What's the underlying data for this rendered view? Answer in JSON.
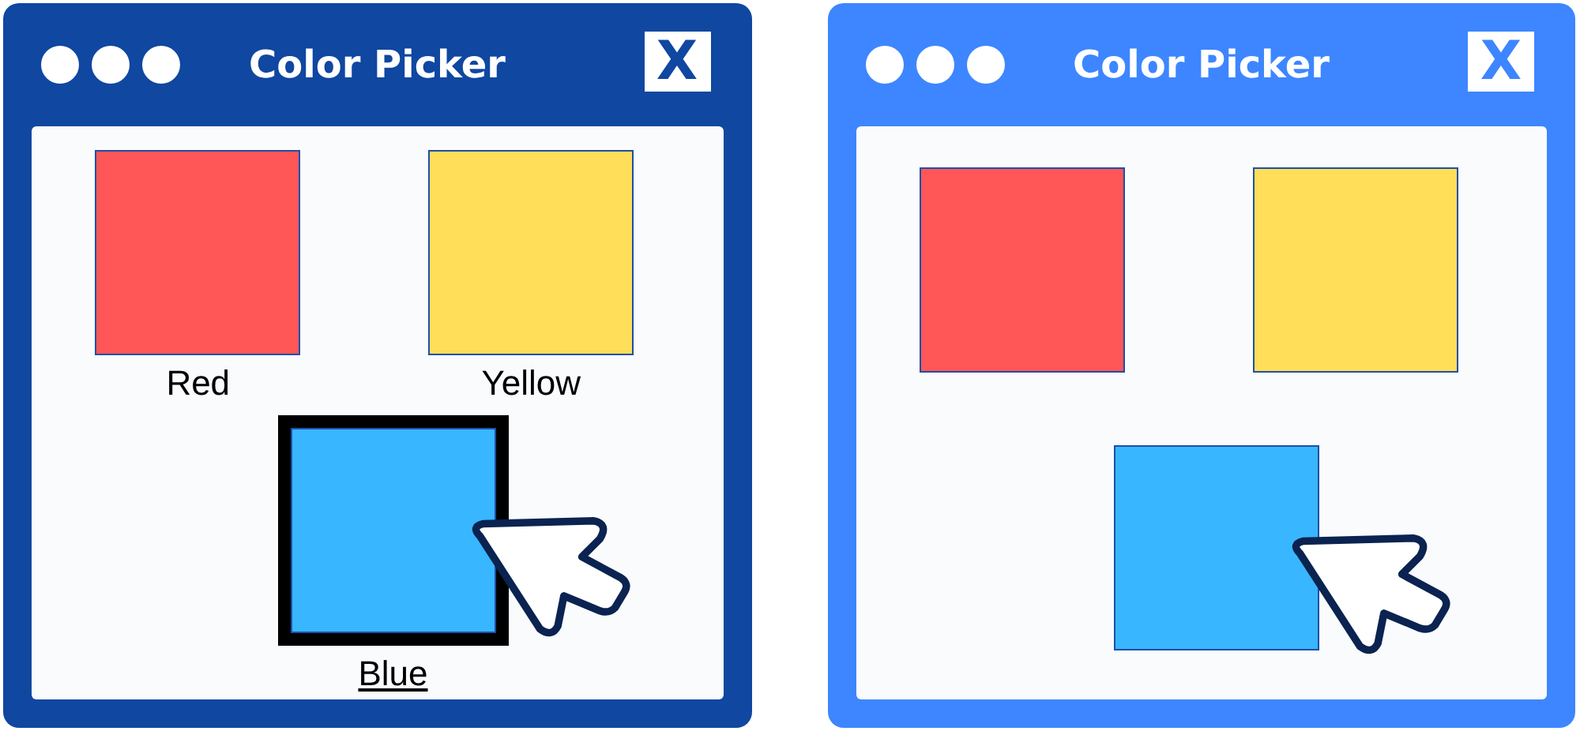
{
  "windows": [
    {
      "title": "Color Picker",
      "close": "X",
      "color": "#0f47a1",
      "swatches": [
        {
          "color": "#ff5757",
          "label": "Red",
          "selected": false,
          "hovered": false
        },
        {
          "color": "#ffde59",
          "label": "Yellow",
          "selected": false,
          "hovered": false
        },
        {
          "color": "#38b6ff",
          "label": "Blue",
          "selected": true,
          "hovered": true
        }
      ]
    },
    {
      "title": "Color Picker",
      "close": "X",
      "color": "#3d86ff",
      "swatches": [
        {
          "color": "#ff5757",
          "selected": false,
          "hovered": false
        },
        {
          "color": "#ffde59",
          "selected": false,
          "hovered": false
        },
        {
          "color": "#38b6ff",
          "selected": false,
          "hovered": true
        }
      ]
    }
  ]
}
